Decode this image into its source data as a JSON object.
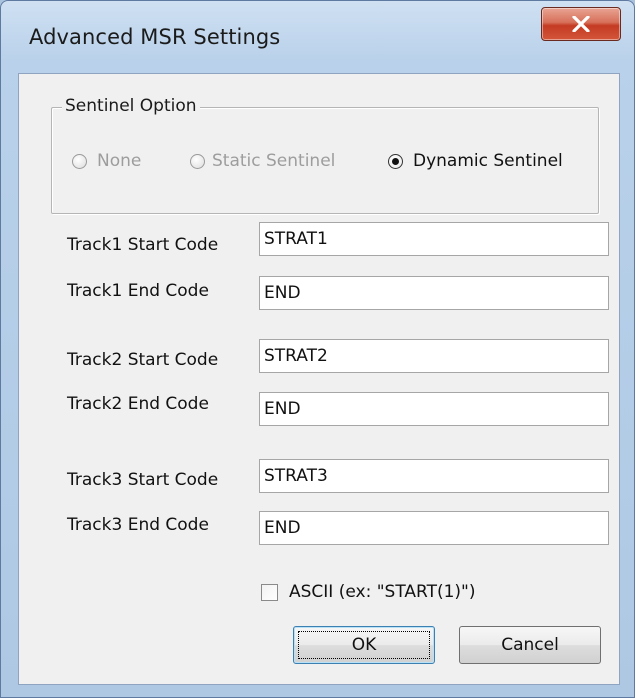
{
  "window": {
    "title": "Advanced MSR Settings"
  },
  "sentinel": {
    "group_label": "Sentinel Option",
    "options": [
      {
        "label": "None",
        "checked": false,
        "enabled": false
      },
      {
        "label": "Static Sentinel",
        "checked": false,
        "enabled": false
      },
      {
        "label": "Dynamic Sentinel",
        "checked": true,
        "enabled": true
      }
    ]
  },
  "tracks": [
    {
      "start_label": "Track1 Start Code",
      "start_value": "STRAT1",
      "end_label": "Track1 End Code",
      "end_value": "END"
    },
    {
      "start_label": "Track2 Start Code",
      "start_value": "STRAT2",
      "end_label": "Track2 End Code",
      "end_value": "END"
    },
    {
      "start_label": "Track3 Start Code",
      "start_value": "STRAT3",
      "end_label": "Track3 End Code",
      "end_value": "END"
    }
  ],
  "ascii": {
    "label": "ASCII (ex: \"START(1)\")",
    "checked": false
  },
  "buttons": {
    "ok": "OK",
    "cancel": "Cancel"
  },
  "colors": {
    "close_button": "#c43b22",
    "disabled_text": "#9d9d9d"
  }
}
